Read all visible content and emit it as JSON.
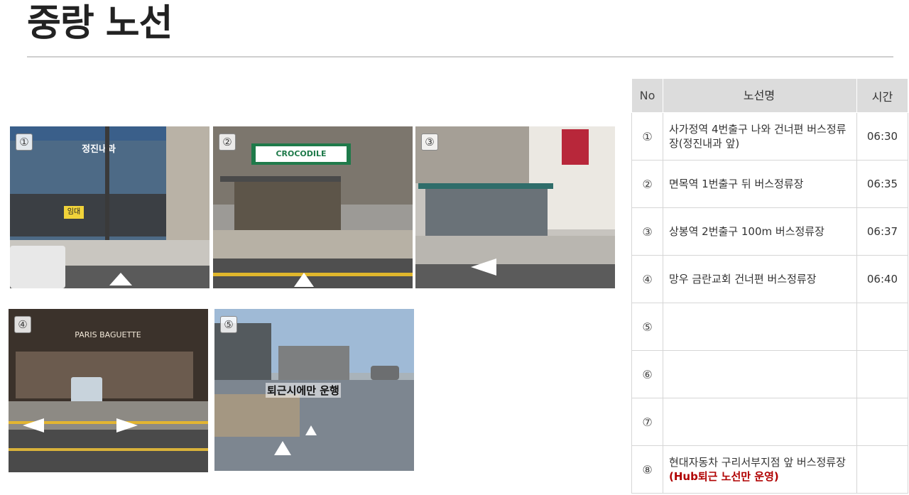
{
  "page": {
    "title": "중랑 노선"
  },
  "photos": [
    {
      "num": "①",
      "sign": "정진내과",
      "extra": "임대"
    },
    {
      "num": "②",
      "sign": "CROCODILE",
      "extra": ""
    },
    {
      "num": "③",
      "sign": "",
      "extra": ""
    },
    {
      "num": "④",
      "sign": "PARIS BAGUETTE",
      "extra": ""
    },
    {
      "num": "⑤",
      "sign": "",
      "caption": "퇴근시에만 운행"
    }
  ],
  "table": {
    "headers": {
      "no": "No",
      "name": "노선명",
      "time": "시간"
    },
    "rows": [
      {
        "no": "①",
        "name": "사가정역 4번출구 나와 건너편 버스정류장(정진내과 앞)",
        "note": "",
        "time": "06:30"
      },
      {
        "no": "②",
        "name": "면목역 1번출구 뒤 버스정류장",
        "note": "",
        "time": "06:35"
      },
      {
        "no": "③",
        "name": "상봉역 2번출구 100m 버스정류장",
        "note": "",
        "time": "06:37"
      },
      {
        "no": "④",
        "name": "망우 금란교회 건너편 버스정류장",
        "note": "",
        "time": "06:40"
      },
      {
        "no": "⑤",
        "name": "",
        "note": "",
        "time": ""
      },
      {
        "no": "⑥",
        "name": "",
        "note": "",
        "time": ""
      },
      {
        "no": "⑦",
        "name": "",
        "note": "",
        "time": ""
      },
      {
        "no": "⑧",
        "name": "현대자동차 구리서부지점 앞 버스정류장 ",
        "note": "(Hub퇴근 노선만 운영)",
        "time": ""
      }
    ]
  }
}
